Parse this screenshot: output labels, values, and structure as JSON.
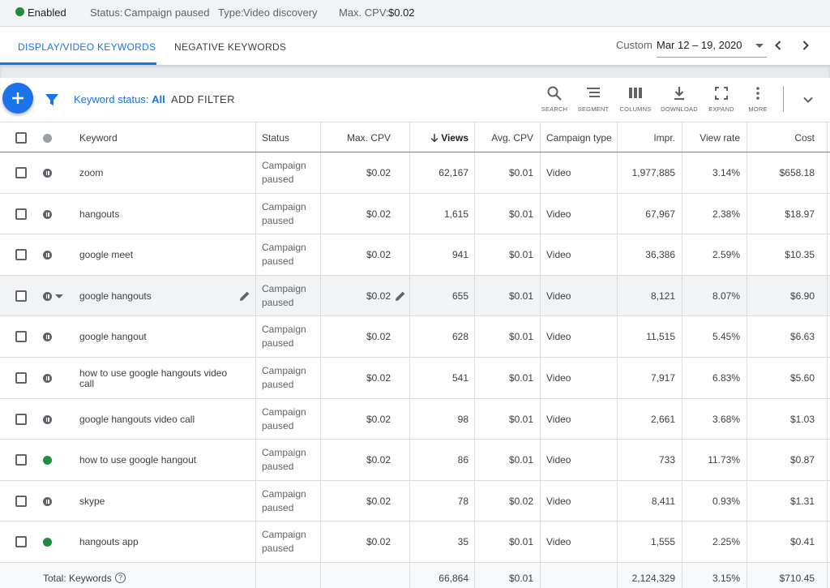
{
  "status_bar": {
    "campaign_state": "Enabled",
    "status_label": "Status:",
    "status_value": "Campaign paused",
    "type_label": "Type:",
    "type_value": "Video discovery",
    "cpv_label": "Max. CPV:",
    "cpv_value": "$0.02",
    "enabled_color": "#1e8e3e"
  },
  "tabs": [
    {
      "label": "DISPLAY/VIDEO KEYWORDS",
      "active": true
    },
    {
      "label": "NEGATIVE KEYWORDS",
      "active": false
    }
  ],
  "date_range": {
    "label": "Custom",
    "value": "Mar 12 – 19, 2020",
    "prev_icon": "chevron-left-icon",
    "next_icon": "chevron-right-icon"
  },
  "toolbar": {
    "add_icon": "plus-icon",
    "filter_icon": "filter-icon",
    "keyword_status_label": "Keyword status:",
    "keyword_status_value": "All",
    "add_filter": "ADD FILTER",
    "tools": [
      {
        "label": "SEARCH",
        "icon": "search-icon"
      },
      {
        "label": "SEGMENT",
        "icon": "segment-icon"
      },
      {
        "label": "COLUMNS",
        "icon": "columns-icon"
      },
      {
        "label": "DOWNLOAD",
        "icon": "download-icon"
      },
      {
        "label": "EXPAND",
        "icon": "expand-icon"
      },
      {
        "label": "MORE",
        "icon": "more-vert-icon"
      }
    ],
    "collapse_icon": "chevron-down-icon",
    "accent_color": "#1a73e8"
  },
  "table": {
    "columns": {
      "keyword": "Keyword",
      "status": "Status",
      "max_cpv": "Max. CPV",
      "views": "Views",
      "avg_cpv": "Avg. CPV",
      "campaign_type": "Campaign type",
      "impr": "Impr.",
      "view_rate": "View rate",
      "cost": "Cost"
    },
    "sort_icon": "arrow-down-icon",
    "rows": [
      {
        "state": "paused",
        "keyword": "zoom",
        "status": [
          "Campaign",
          "paused"
        ],
        "max_cpv": "$0.02",
        "views": "62,167",
        "avg_cpv": "$0.01",
        "campaign_type": "Video",
        "impr": "1,977,885",
        "view_rate": "3.14%",
        "cost": "$658.18"
      },
      {
        "state": "paused",
        "keyword": "hangouts",
        "status": [
          "Campaign",
          "paused"
        ],
        "max_cpv": "$0.02",
        "views": "1,615",
        "avg_cpv": "$0.01",
        "campaign_type": "Video",
        "impr": "67,967",
        "view_rate": "2.38%",
        "cost": "$18.97"
      },
      {
        "state": "paused",
        "keyword": "google meet",
        "status": [
          "Campaign",
          "paused"
        ],
        "max_cpv": "$0.02",
        "views": "941",
        "avg_cpv": "$0.01",
        "campaign_type": "Video",
        "impr": "36,386",
        "view_rate": "2.59%",
        "cost": "$10.35"
      },
      {
        "state": "paused",
        "keyword": "google hangouts",
        "status": [
          "Campaign",
          "paused"
        ],
        "max_cpv": "$0.02",
        "views": "655",
        "avg_cpv": "$0.01",
        "campaign_type": "Video",
        "impr": "8,121",
        "view_rate": "8.07%",
        "cost": "$6.90",
        "highlighted": true
      },
      {
        "state": "paused",
        "keyword": "google hangout",
        "status": [
          "Campaign",
          "paused"
        ],
        "max_cpv": "$0.02",
        "views": "628",
        "avg_cpv": "$0.01",
        "campaign_type": "Video",
        "impr": "11,515",
        "view_rate": "5.45%",
        "cost": "$6.63"
      },
      {
        "state": "paused",
        "keyword": [
          "how to use google hangouts video",
          "call"
        ],
        "status": [
          "Campaign",
          "paused"
        ],
        "max_cpv": "$0.02",
        "views": "541",
        "avg_cpv": "$0.01",
        "campaign_type": "Video",
        "impr": "7,917",
        "view_rate": "6.83%",
        "cost": "$5.60"
      },
      {
        "state": "paused",
        "keyword": "google hangouts video call",
        "status": [
          "Campaign",
          "paused"
        ],
        "max_cpv": "$0.02",
        "views": "98",
        "avg_cpv": "$0.01",
        "campaign_type": "Video",
        "impr": "2,661",
        "view_rate": "3.68%",
        "cost": "$1.03"
      },
      {
        "state": "enabled",
        "keyword": "how to use google hangout",
        "status": [
          "Campaign",
          "paused"
        ],
        "max_cpv": "$0.02",
        "views": "86",
        "avg_cpv": "$0.01",
        "campaign_type": "Video",
        "impr": "733",
        "view_rate": "11.73%",
        "cost": "$0.87"
      },
      {
        "state": "paused",
        "keyword": "skype",
        "status": [
          "Campaign",
          "paused"
        ],
        "max_cpv": "$0.02",
        "views": "78",
        "avg_cpv": "$0.02",
        "campaign_type": "Video",
        "impr": "8,411",
        "view_rate": "0.93%",
        "cost": "$1.31"
      },
      {
        "state": "enabled",
        "keyword": "hangouts app",
        "status": [
          "Campaign",
          "paused"
        ],
        "max_cpv": "$0.02",
        "views": "35",
        "avg_cpv": "$0.01",
        "campaign_type": "Video",
        "impr": "1,555",
        "view_rate": "2.25%",
        "cost": "$0.41"
      }
    ],
    "total": {
      "label": "Total: Keywords",
      "help_icon": "?",
      "views": "66,864",
      "avg_cpv": "$0.01",
      "impr": "2,124,329",
      "view_rate": "3.15%",
      "cost": "$710.45"
    }
  }
}
